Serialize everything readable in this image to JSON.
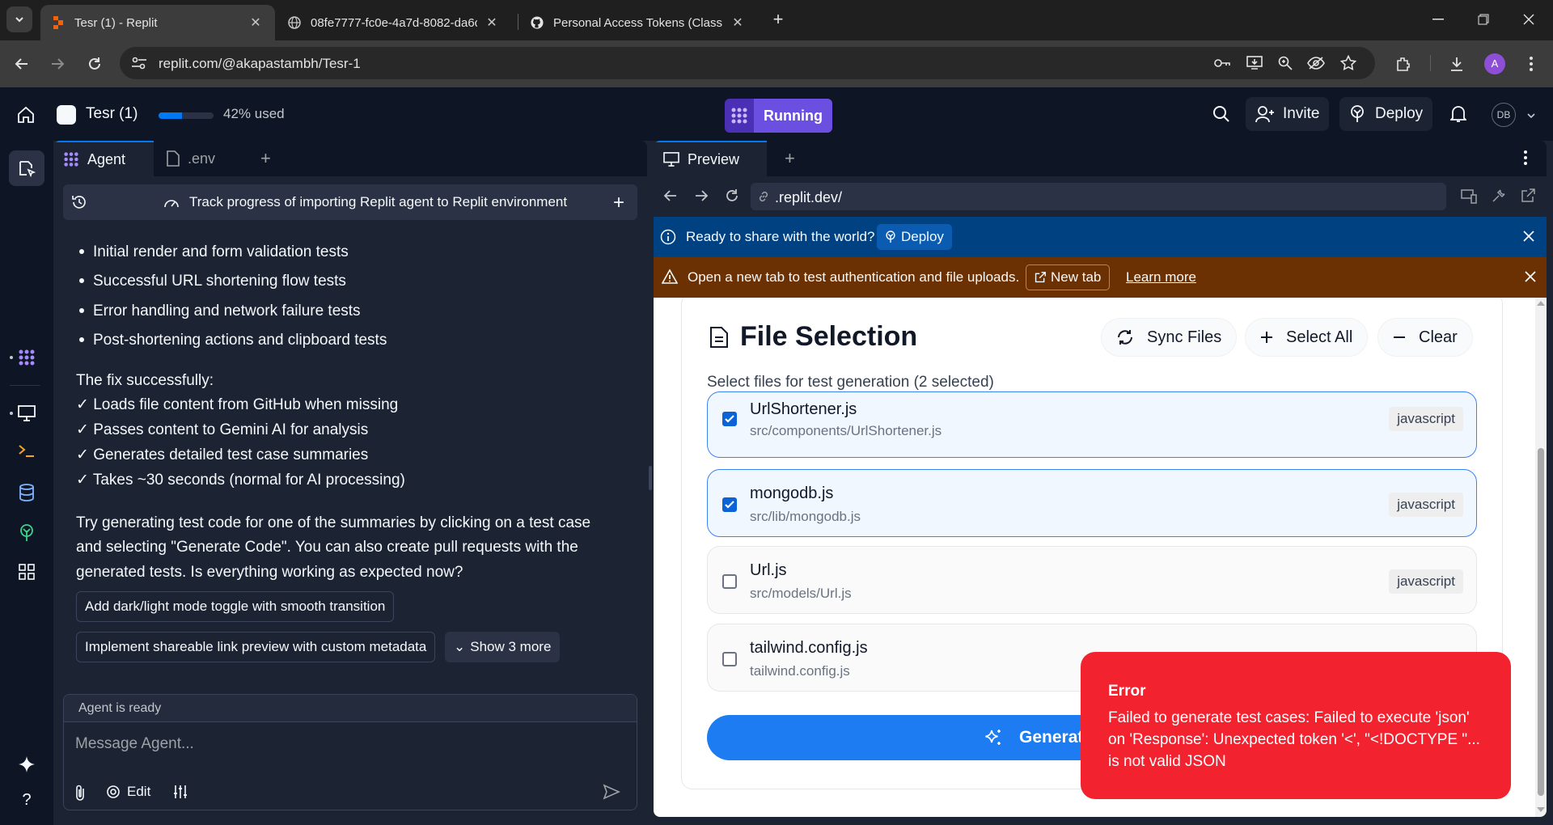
{
  "browser": {
    "tabs": [
      {
        "title": "Tesr (1) - Replit",
        "close": "✕",
        "active": true
      },
      {
        "title": "08fe7777-fc0e-4a7d-8082-da6c",
        "close": "✕",
        "active": false
      },
      {
        "title": "Personal Access Tokens (Classic)",
        "close": "✕",
        "active": false
      }
    ],
    "new_tab": "+",
    "url": "replit.com/@akapastambh/Tesr-1",
    "profile_initial": "A"
  },
  "header": {
    "repl_name": "Tesr (1)",
    "usage_fraction": 0.42,
    "usage_text": "42% used",
    "run_label": "Running",
    "invite_label": "Invite",
    "deploy_label": "Deploy",
    "user_initials": "DB"
  },
  "agent": {
    "tabs": [
      {
        "label": "Agent"
      },
      {
        "label": ".env"
      }
    ],
    "add_tab": "+",
    "track_title": "Track progress of importing Replit agent to Replit environment",
    "bullets": [
      "Initial render and form validation tests",
      "Successful URL shortening flow tests",
      "Error handling and network failure tests",
      "Post-shortening actions and clipboard tests"
    ],
    "fix_heading": "The fix successfully:",
    "fix_items": [
      "✓ Loads file content from GitHub when missing",
      "✓ Passes content to Gemini AI for analysis",
      "✓ Generates detailed test case summaries",
      "✓ Takes ~30 seconds (normal for AI processing)"
    ],
    "closing_lines": [
      "Try generating test code for one of the summaries by clicking on a test case",
      "and selecting \"Generate Code\". You can also create pull requests with the",
      "generated tests. Is everything working as expected now?"
    ],
    "suggestions": [
      "Add dark/light mode toggle with smooth transition",
      "Implement shareable link preview with custom metadata"
    ],
    "show_more": "Show 3 more",
    "status": "Agent is ready",
    "placeholder": "Message Agent...",
    "edit_label": "Edit"
  },
  "preview": {
    "tab_label": "Preview",
    "add_tab": "+",
    "address": ".replit.dev/",
    "share_banner": {
      "text": "Ready to share with the world?",
      "button": "Deploy"
    },
    "warn_banner": {
      "text": "Open a new tab to test authentication and file uploads.",
      "button": "New tab",
      "link": "Learn more"
    },
    "card": {
      "title": "File Selection",
      "subtitle": "Select files for test generation (2 selected)",
      "sync_label": "Sync Files",
      "select_all_label": "Select All",
      "clear_label": "Clear",
      "files": [
        {
          "name": "UrlShortener.js",
          "path": "src/components/UrlShortener.js",
          "lang": "javascript",
          "checked": true
        },
        {
          "name": "mongodb.js",
          "path": "src/lib/mongodb.js",
          "lang": "javascript",
          "checked": true
        },
        {
          "name": "Url.js",
          "path": "src/models/Url.js",
          "lang": "javascript",
          "checked": false
        },
        {
          "name": "tailwind.config.js",
          "path": "tailwind.config.js",
          "lang": "",
          "checked": false
        }
      ],
      "generate_label": "Generate"
    }
  },
  "toast": {
    "title": "Error",
    "message": "Failed to generate test cases: Failed to execute 'json' on 'Response': Unexpected token '<', \"<!DOCTYPE \"... is not valid JSON"
  },
  "colors": {
    "accent": "#0079f2",
    "running": "#6b4fe0",
    "error": "#f2222f",
    "share_banner": "#004182",
    "warn_banner": "#6b3102"
  }
}
